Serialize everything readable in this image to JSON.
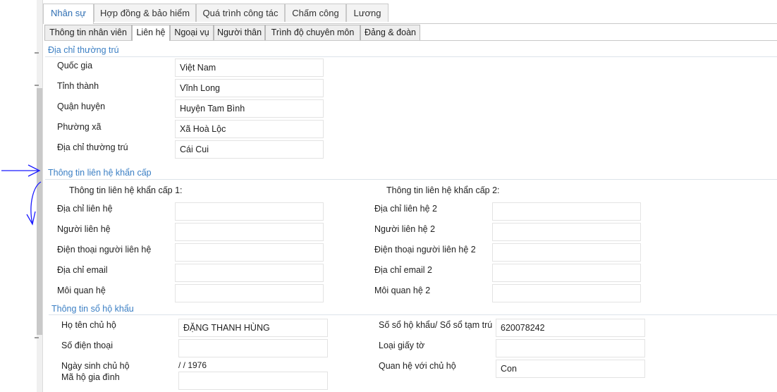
{
  "main_tabs": [
    "Nhân sự",
    "Hợp đồng & bảo hiểm",
    "Quá trình công tác",
    "Chấm công",
    "Lương"
  ],
  "sub_tabs": [
    "Thông tin nhân viên",
    "Liên hệ",
    "Ngoại vụ",
    "Người thân",
    "Trình độ chuyên môn",
    "Đảng & đoàn"
  ],
  "permanent_address": {
    "title": "Địa chỉ thường trú",
    "fields": [
      {
        "label": "Quốc gia",
        "value": "Việt Nam"
      },
      {
        "label": "Tỉnh thành",
        "value": "Vĩnh Long"
      },
      {
        "label": "Quận huyện",
        "value": "Huyện Tam Bình"
      },
      {
        "label": "Phường xã",
        "value": "Xã Hoà Lộc"
      },
      {
        "label": "Địa chỉ thường trú",
        "value": "Cái Cui"
      }
    ]
  },
  "emergency": {
    "title": "Thông tin liên hệ khẩn cấp",
    "contact1": {
      "heading": "Thông tin liên hệ khẩn cấp 1:",
      "fields": [
        {
          "label": "Địa chỉ liên hệ",
          "value": ""
        },
        {
          "label": "Người liên hệ",
          "value": ""
        },
        {
          "label": "Điện thoại người liên hệ",
          "value": ""
        },
        {
          "label": "Địa chỉ email",
          "value": ""
        },
        {
          "label": "Môi quan hệ",
          "value": ""
        }
      ]
    },
    "contact2": {
      "heading": "Thông tin liên hệ khẩn cấp 2:",
      "fields": [
        {
          "label": "Địa chỉ liên hệ 2",
          "value": ""
        },
        {
          "label": "Người liên hệ 2",
          "value": ""
        },
        {
          "label": "Điện thoại người liên hệ 2",
          "value": ""
        },
        {
          "label": "Địa chỉ email 2",
          "value": ""
        },
        {
          "label": "Môi quan hệ 2",
          "value": ""
        }
      ]
    }
  },
  "household": {
    "title": "Thông tin sổ hộ khẩu",
    "head_name_label": "Họ tên chủ hộ",
    "head_name_value": "ĐẶNG THANH HÙNG",
    "phone_label": "Số điện thoại",
    "phone_value": "",
    "head_dob_label": "Ngày sinh chủ hộ",
    "head_dob_value": "/ / 1976",
    "family_code_label": "Mã hộ gia đình",
    "family_code_value": "",
    "book_no_label": "Số sổ hộ khẩu/ Sổ sổ tạm trú",
    "book_no_value": "620078242",
    "doc_type_label": "Loại giấy tờ",
    "doc_type_value": "",
    "relation_label": "Quan hệ với chủ hộ",
    "relation_value": "Con"
  },
  "colors": {
    "accent": "#3b7fc4",
    "annotation": "#1a1aff"
  }
}
